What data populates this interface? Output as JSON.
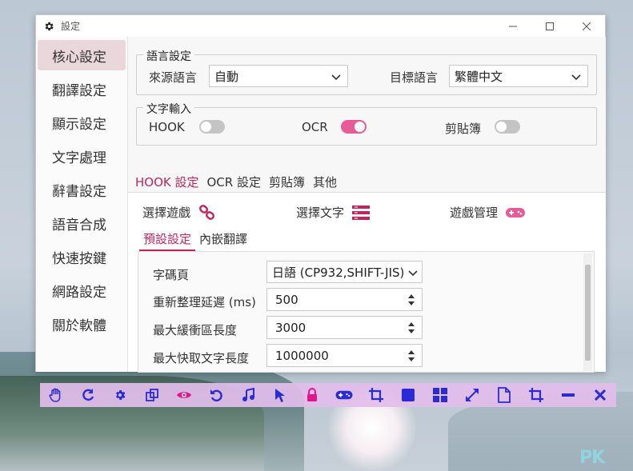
{
  "window": {
    "title": "設定"
  },
  "sidebar": {
    "items": [
      {
        "label": "核心設定",
        "active": true
      },
      {
        "label": "翻譯設定"
      },
      {
        "label": "顯示設定"
      },
      {
        "label": "文字處理"
      },
      {
        "label": "辭書設定"
      },
      {
        "label": "語音合成"
      },
      {
        "label": "快速按鍵"
      },
      {
        "label": "網路設定"
      },
      {
        "label": "關於軟體"
      }
    ]
  },
  "language": {
    "legend": "語言設定",
    "source_label": "來源語言",
    "source_value": "自動",
    "target_label": "目標語言",
    "target_value": "繁體中文"
  },
  "text_input": {
    "legend": "文字輸入",
    "hook_label": "HOOK",
    "hook_on": false,
    "ocr_label": "OCR",
    "ocr_on": true,
    "clipboard_label": "剪貼簿",
    "clipboard_on": false
  },
  "tabs": [
    "HOOK 設定",
    "OCR 設定",
    "剪貼簿",
    "其他"
  ],
  "hook_panel": {
    "select_game": "選擇遊戲",
    "select_text": "選擇文字",
    "game_manage": "遊戲管理",
    "subtabs": [
      "預設設定",
      "內嵌翻譯"
    ],
    "codepage_label": "字碼頁",
    "codepage_value": "日語 (CP932,SHIFT-JIS)",
    "refresh_label": "重新整理延遲 (ms)",
    "refresh_value": "500",
    "buffer_label": "最大緩衝區長度",
    "buffer_value": "3000",
    "cache_label": "最大快取文字長度",
    "cache_value": "1000000"
  },
  "colors": {
    "accent": "#c2255c",
    "toggle_on": "#e85a98",
    "toolbar_icon": "#2b2bd6",
    "toolbar_highlight": "#e0168c"
  },
  "toolbar_icons": [
    "hand-icon",
    "refresh-icon",
    "gear-icon",
    "copy-icon",
    "eye-icon",
    "undo-icon",
    "music-icon",
    "pointer-icon",
    "lock-icon",
    "gamepad-icon",
    "crop-icon",
    "square-icon",
    "windows-icon",
    "expand-icon",
    "file-icon",
    "crop2-icon",
    "minimize-icon",
    "close-icon"
  ],
  "watermark": "PK"
}
